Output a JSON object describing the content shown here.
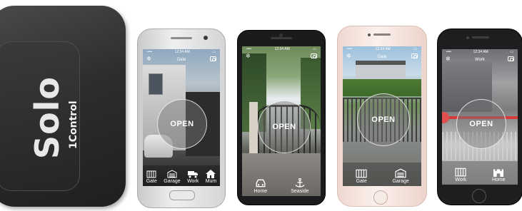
{
  "device": {
    "brand_solo": "Solo",
    "brand_control": "1Control"
  },
  "phones": [
    {
      "status_time": "12:34 AM",
      "screen_title": "Gate",
      "open_label": "OPEN",
      "tabs": [
        {
          "label": "Gate",
          "icon": "gate-icon"
        },
        {
          "label": "Garage",
          "icon": "garage-icon"
        },
        {
          "label": "Work",
          "icon": "truck-icon"
        },
        {
          "label": "Mum",
          "icon": "home-icon"
        }
      ]
    },
    {
      "status_time": "12:34 AM",
      "screen_title": "",
      "open_label": "OPEN",
      "tabs": [
        {
          "label": "Home",
          "icon": "car-icon"
        },
        {
          "label": "Seaside",
          "icon": "anchor-icon"
        }
      ]
    },
    {
      "status_time": "12:34 AM",
      "screen_title": "Gate",
      "open_label": "OPEN",
      "tabs": [
        {
          "label": "Gate",
          "icon": "gate-icon"
        },
        {
          "label": "Garage",
          "icon": "garage-icon"
        }
      ]
    },
    {
      "status_time": "12:34 AM",
      "screen_title": "Work",
      "open_label": "OPEN",
      "tabs": [
        {
          "label": "Work",
          "icon": "gate-icon"
        },
        {
          "label": "Home",
          "icon": "castle-icon"
        }
      ]
    }
  ],
  "colors": {
    "device_body": "#2d2d2f",
    "phone_silver": "#d9dadc",
    "phone_black": "#1c1c1e",
    "phone_rose": "#f3e2dc"
  }
}
